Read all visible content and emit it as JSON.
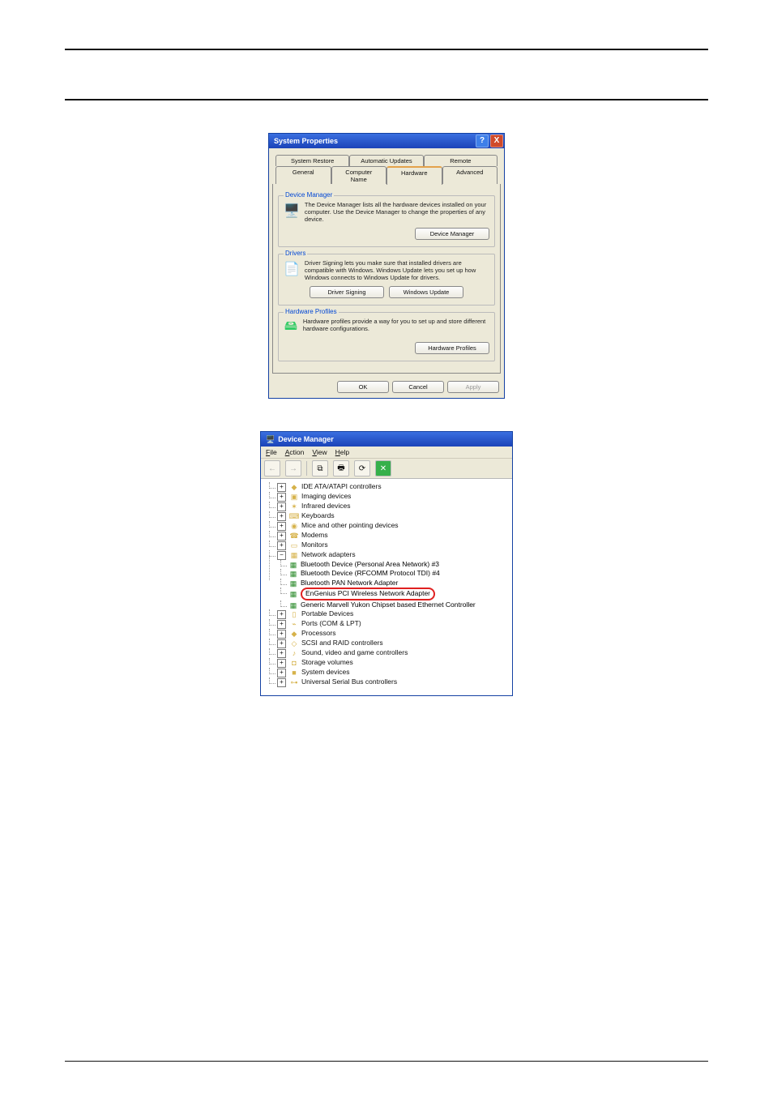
{
  "sysprops": {
    "title": "System Properties",
    "help": "?",
    "close": "X",
    "tabs_row1": [
      "System Restore",
      "Automatic Updates",
      "Remote"
    ],
    "tabs_row2": [
      "General",
      "Computer Name",
      "Hardware",
      "Advanced"
    ],
    "active_tab": "Hardware",
    "device_manager": {
      "legend": "Device Manager",
      "desc": "The Device Manager lists all the hardware devices installed on your computer. Use the Device Manager to change the properties of any device.",
      "button": "Device Manager"
    },
    "drivers": {
      "legend": "Drivers",
      "desc": "Driver Signing lets you make sure that installed drivers are compatible with Windows. Windows Update lets you set up how Windows connects to Windows Update for drivers.",
      "button1": "Driver Signing",
      "button2": "Windows Update"
    },
    "hardware_profiles": {
      "legend": "Hardware Profiles",
      "desc": "Hardware profiles provide a way for you to set up and store different hardware configurations.",
      "button": "Hardware Profiles"
    },
    "dlg_buttons": {
      "ok": "OK",
      "cancel": "Cancel",
      "apply": "Apply"
    }
  },
  "devmgr": {
    "title": "Device Manager",
    "menu": {
      "file": "File",
      "action": "Action",
      "view": "View",
      "help": "Help"
    },
    "toolbar": {
      "back": "←",
      "forward": "→",
      "properties": "⧉",
      "print": "🖶",
      "refresh": "⟳",
      "uninstall": "✕"
    },
    "tree": [
      {
        "expand": "+",
        "label": "IDE ATA/ATAPI controllers",
        "icon": "◆"
      },
      {
        "expand": "+",
        "label": "Imaging devices",
        "icon": "▣"
      },
      {
        "expand": "+",
        "label": "Infrared devices",
        "icon": "✶"
      },
      {
        "expand": "+",
        "label": "Keyboards",
        "icon": "⌨"
      },
      {
        "expand": "+",
        "label": "Mice and other pointing devices",
        "icon": "◉"
      },
      {
        "expand": "+",
        "label": "Modems",
        "icon": "☎"
      },
      {
        "expand": "+",
        "label": "Monitors",
        "icon": "▭"
      },
      {
        "expand": "−",
        "label": "Network adapters",
        "icon": "▦",
        "children": [
          "Bluetooth Device (Personal Area Network) #3",
          "Bluetooth Device (RFCOMM Protocol TDI) #4",
          "Bluetooth PAN Network Adapter",
          "EnGenius PCI Wireless Network Adapter",
          "Generic Marvell Yukon Chipset based Ethernet Controller"
        ],
        "selected_index": 3
      },
      {
        "expand": "+",
        "label": "Portable Devices",
        "icon": "▯"
      },
      {
        "expand": "+",
        "label": "Ports (COM & LPT)",
        "icon": "⌁"
      },
      {
        "expand": "+",
        "label": "Processors",
        "icon": "◆"
      },
      {
        "expand": "+",
        "label": "SCSI and RAID controllers",
        "icon": "◇"
      },
      {
        "expand": "+",
        "label": "Sound, video and game controllers",
        "icon": "♪"
      },
      {
        "expand": "+",
        "label": "Storage volumes",
        "icon": "◘"
      },
      {
        "expand": "+",
        "label": "System devices",
        "icon": "■"
      },
      {
        "expand": "+",
        "label": "Universal Serial Bus controllers",
        "icon": "⊶"
      }
    ]
  }
}
